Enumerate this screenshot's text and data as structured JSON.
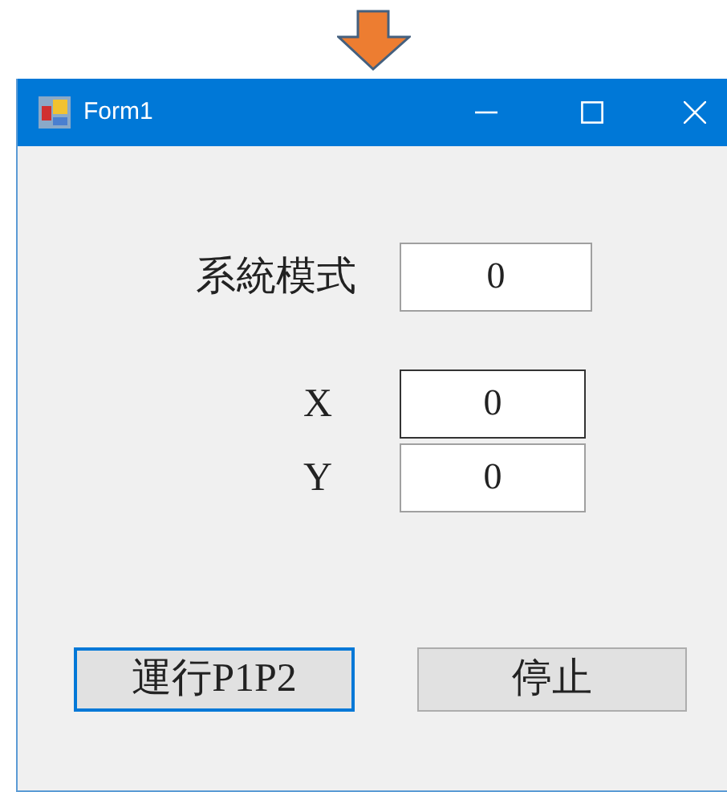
{
  "window": {
    "title": "Form1"
  },
  "fields": [
    {
      "kind": "mode",
      "label": "系統模式",
      "value": "0",
      "focused": false
    },
    {
      "kind": "coordinate",
      "label": "X",
      "value": "0",
      "focused": true
    },
    {
      "kind": "coordinate",
      "label": "Y",
      "value": "0",
      "focused": false
    }
  ],
  "buttons": [
    {
      "label": "運行P1P2",
      "focused": true
    },
    {
      "label": "停止",
      "focused": false
    }
  ]
}
